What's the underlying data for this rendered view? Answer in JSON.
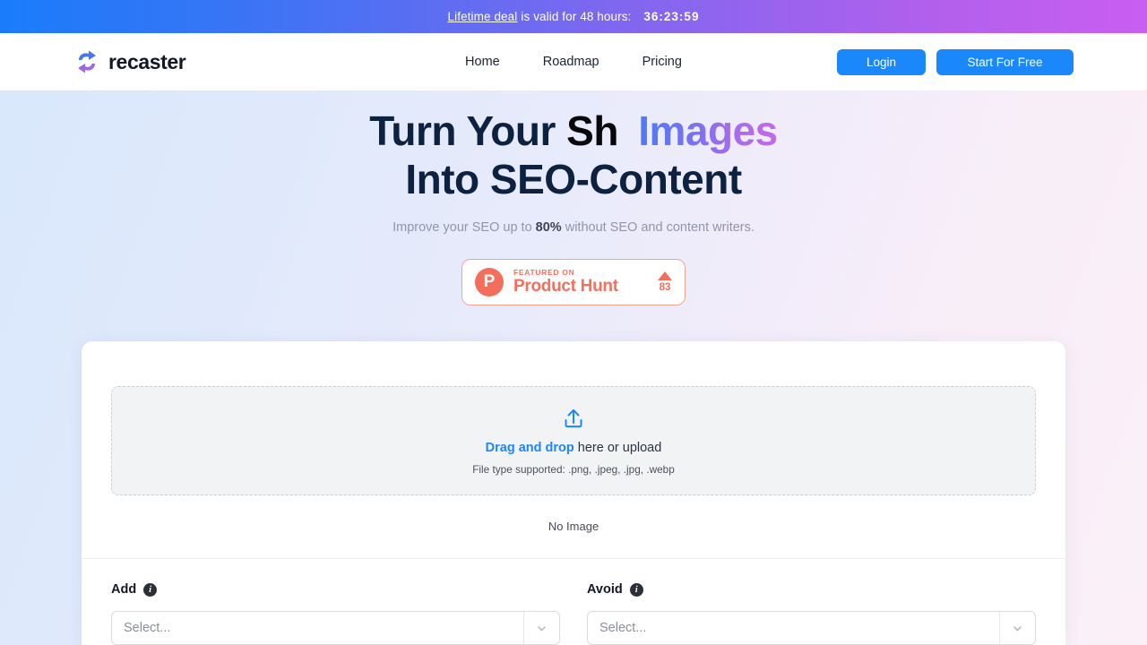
{
  "banner": {
    "link_text": "Lifetime deal",
    "middle_text": "is valid for 48 hours:",
    "timer": "36:23:59",
    "gradient_from": "#1a7cfa",
    "gradient_to": "#c95ef2"
  },
  "header": {
    "logo_text": "recaster",
    "logo_icon": "recycle-arrows-icon",
    "nav": [
      {
        "label": "Home"
      },
      {
        "label": "Roadmap"
      },
      {
        "label": "Pricing"
      }
    ],
    "login_label": "Login",
    "start_label": "Start For Free",
    "button_color": "#1a88fa"
  },
  "hero": {
    "title_part1": "Turn Your",
    "title_part2": "Sh",
    "title_gradient": "Images",
    "title_line2": "Into SEO-Content",
    "subtitle_before": "Improve your SEO up to",
    "subtitle_highlight": "80%",
    "subtitle_after": "without SEO and content writers.",
    "gradient_from": "#4a7cf5",
    "gradient_to": "#c46ae8"
  },
  "product_hunt": {
    "mark": "P",
    "featured_on": "FEATURED ON",
    "name": "Product Hunt",
    "upvote_icon": "triangle-up-icon",
    "upvote_count": "83",
    "color": "#f4705d"
  },
  "upload": {
    "icon": "upload-arrow-icon",
    "drag_accent": "Drag and drop",
    "drag_rest": "here or upload",
    "file_types": "File type supported: .png, .jpeg, .jpg, .webp",
    "no_image": "No Image",
    "accent_color": "#1a88fa"
  },
  "form": {
    "add": {
      "label": "Add",
      "info_icon": "info-icon",
      "placeholder": "Select...",
      "chevron": "chevron-down-icon"
    },
    "avoid": {
      "label": "Avoid",
      "info_icon": "info-icon",
      "placeholder": "Select...",
      "chevron": "chevron-down-icon"
    }
  }
}
